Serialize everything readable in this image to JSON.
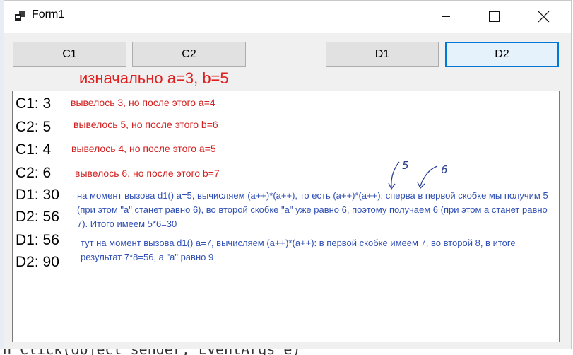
{
  "window": {
    "title": "Form1",
    "controls": {
      "minimize_icon": "minimize-icon",
      "maximize_icon": "maximize-icon",
      "close_icon": "close-icon"
    }
  },
  "buttons": {
    "c1": "C1",
    "c2": "C2",
    "d1": "D1",
    "d2": "D2"
  },
  "initial_note": "изначально a=3, b=5",
  "output": {
    "lines": [
      "C1: 3",
      "C2: 5",
      "C1: 4",
      "C2: 6",
      "D1: 30",
      "D2: 56",
      "D1: 56",
      "D2: 90"
    ]
  },
  "annotations": {
    "c1_first": "вывелось 3, но после этого a=4",
    "c2_first": "вывелось 5, но после этого b=6",
    "c1_second": "вывелось 4, но после этого a=5",
    "c2_second": "вывелось 6, но после этого b=7",
    "d1_first": "на момент вызова d1() a=5, вычисляем (a++)*(a++), то есть (a++)*(a++): сперва в первой скобке мы получим 5 (при этом \"a\" станет равно 6), во второй скобке \"a\" уже равно 6, поэтому получаем 6 (при этом a станет равно 7). Итого имеем 5*6=30",
    "d1_second": "тут на момент вызова d1() a=7, вычисляем (a++)*(a++): в первой скобке имеем 7, во второй 8, в итоге результат 7*8=56, а \"a\" равно 9",
    "handwritten_5": "5",
    "handwritten_6": "6"
  },
  "colors": {
    "title_bar": "#ffffff",
    "form_bg": "#f0f0f0",
    "accent_focus": "#0078d7",
    "note_red": "#e02020",
    "note_blue": "#2f4fb5"
  },
  "background_code": "n_Click(object sender, EventArgs e)"
}
